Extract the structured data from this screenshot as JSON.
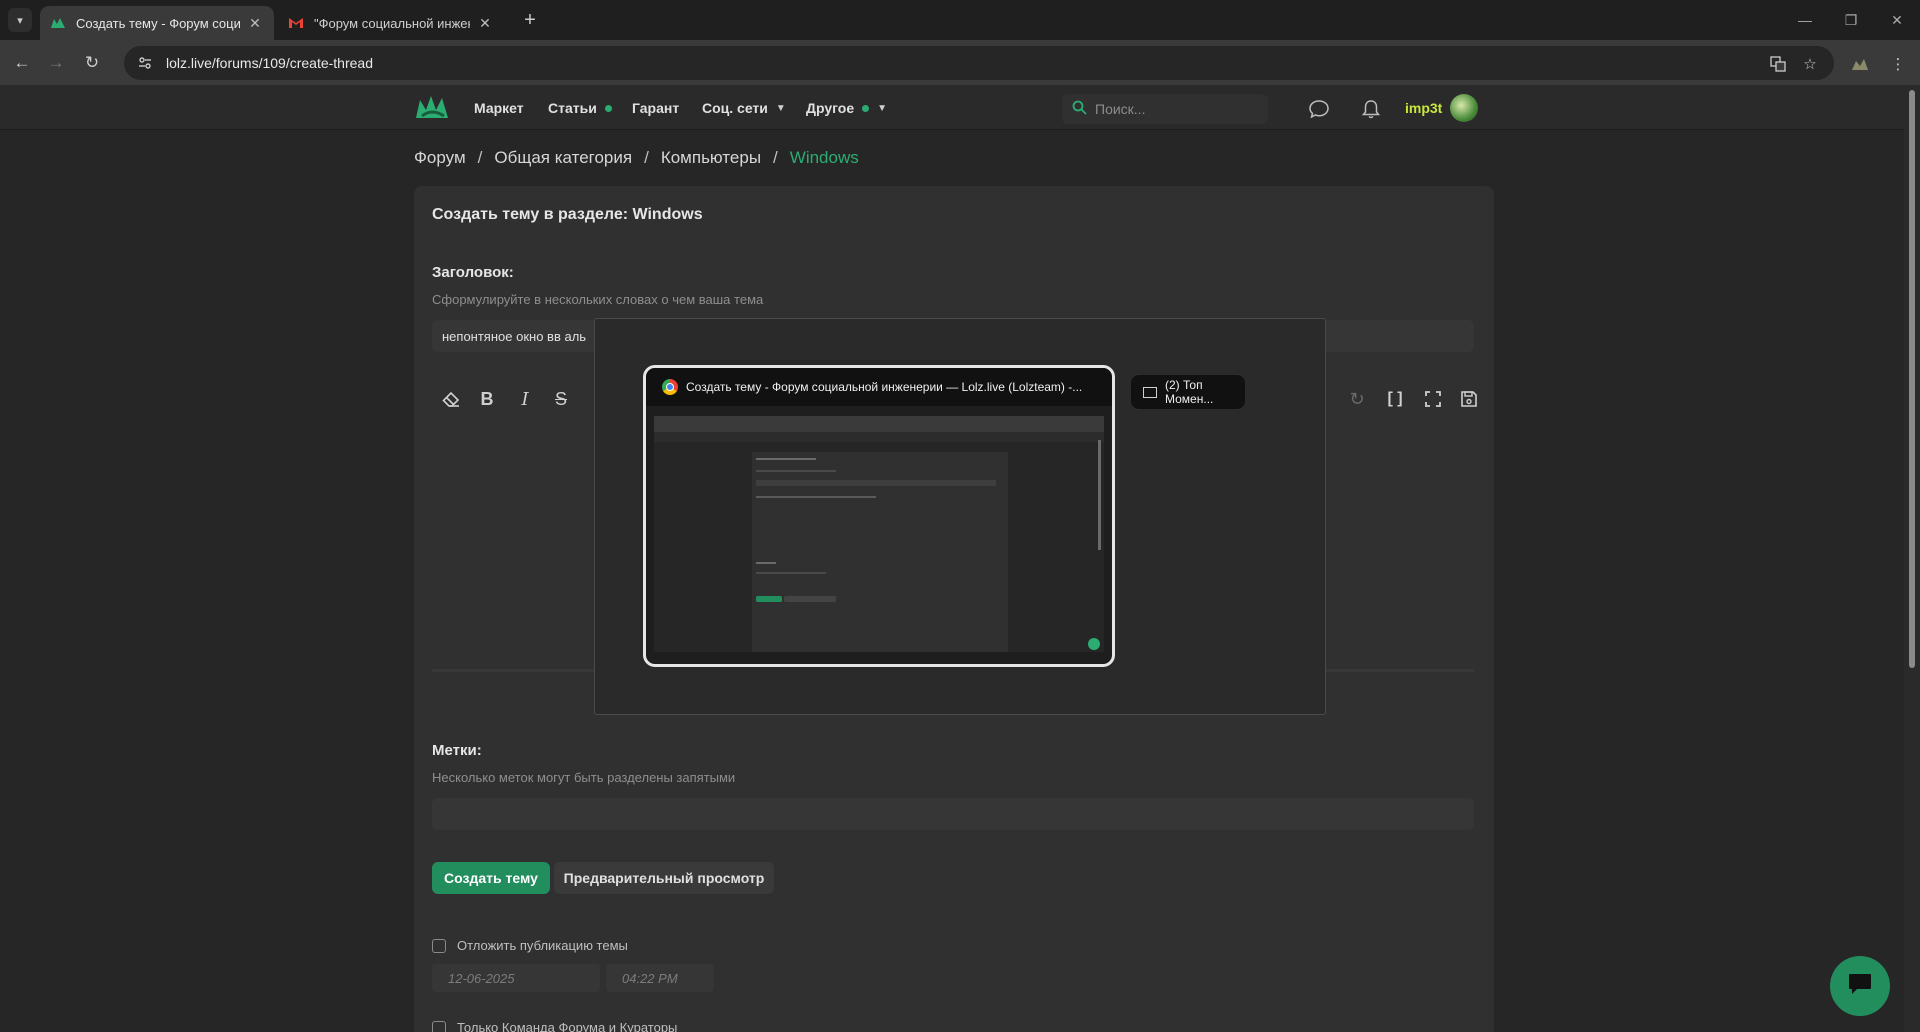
{
  "browser": {
    "tabs": [
      {
        "title": "Создать тему - Форум социал",
        "active": true
      },
      {
        "title": "\"Форум социальной инженер",
        "active": false
      }
    ],
    "url": "lolz.live/forums/109/create-thread"
  },
  "header": {
    "nav": [
      {
        "label": "Маркет",
        "dot": false,
        "chevron": false
      },
      {
        "label": "Статьи",
        "dot": true,
        "chevron": false
      },
      {
        "label": "Гарант",
        "dot": false,
        "chevron": false
      },
      {
        "label": "Соц. сети",
        "dot": false,
        "chevron": true
      },
      {
        "label": "Другое",
        "dot": true,
        "chevron": true
      }
    ],
    "search_placeholder": "Поиск...",
    "username": "imp3t"
  },
  "breadcrumb": [
    "Форум",
    "Общая категория",
    "Компьютеры",
    "Windows"
  ],
  "form": {
    "title": "Создать тему в разделе: Windows",
    "heading_label": "Заголовок:",
    "heading_hint": "Сформулируйте в нескольких словах о чем ваша тема",
    "heading_value": "непонтяное окно вв аль",
    "tags_label": "Метки:",
    "tags_hint": "Несколько меток могут быть разделены запятыми",
    "submit_label": "Создать тему",
    "preview_label": "Предварительный просмотр",
    "delay_label": "Отложить публикацию темы",
    "date_placeholder": "12-06-2025",
    "time_placeholder": "04:22 PM",
    "team_label": "Только Команда Форума и Кураторы"
  },
  "switcher": {
    "selected_title": "Создать тему - Форум социальной инженерии — Lolz.live (Lolzteam) -...",
    "other_title": "(2) Топ Момен..."
  },
  "colors": {
    "accent": "#2bad72",
    "button": "#228e5d",
    "username": "#c7e83b"
  }
}
